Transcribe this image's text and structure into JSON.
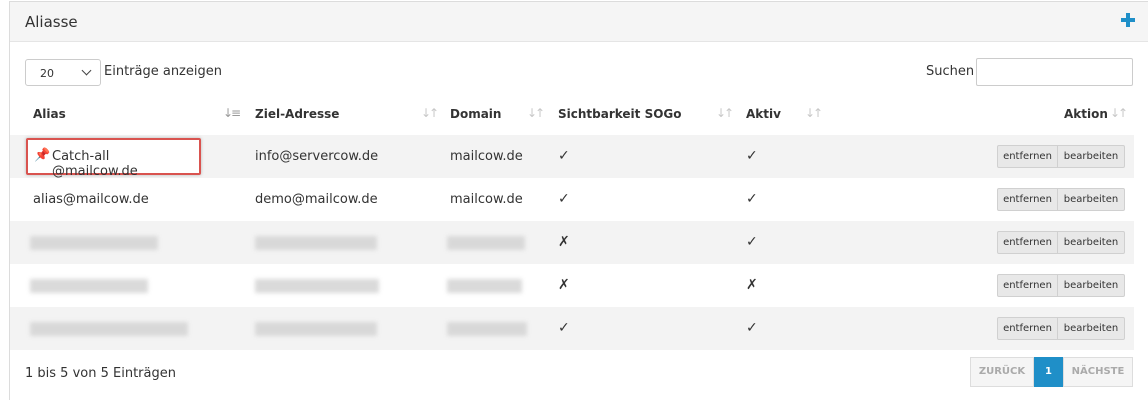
{
  "panel": {
    "title": "Aliasse",
    "add_icon": "plus-icon",
    "accent_color": "#1f8fc8"
  },
  "controls": {
    "length_value": "20",
    "length_label": "Einträge anzeigen",
    "search_label": "Suchen",
    "search_value": ""
  },
  "table": {
    "columns": [
      "Alias",
      "Ziel-Adresse",
      "Domain",
      "Sichtbarkeit SOGo",
      "Aktiv",
      "Aktion"
    ],
    "rows": [
      {
        "alias": "Catch-all @mailcow.de",
        "target": "info@servercow.de",
        "domain": "mailcow.de",
        "sogo": "✓",
        "active": "✓"
      },
      {
        "alias": "alias@mailcow.de",
        "target": "demo@mailcow.de",
        "domain": "mailcow.de",
        "sogo": "✓",
        "active": "✓"
      },
      {
        "sogo": "✗",
        "active": "✓"
      },
      {
        "sogo": "✗",
        "active": "✗"
      },
      {
        "sogo": "✓",
        "active": "✓"
      }
    ],
    "delete_label": "entfernen",
    "edit_label": "bearbeiten"
  },
  "footer": {
    "info": "1 bis 5 von 5 Einträgen",
    "prev": "ZURÜCK",
    "current_page": "1",
    "next": "NÄCHSTE"
  }
}
